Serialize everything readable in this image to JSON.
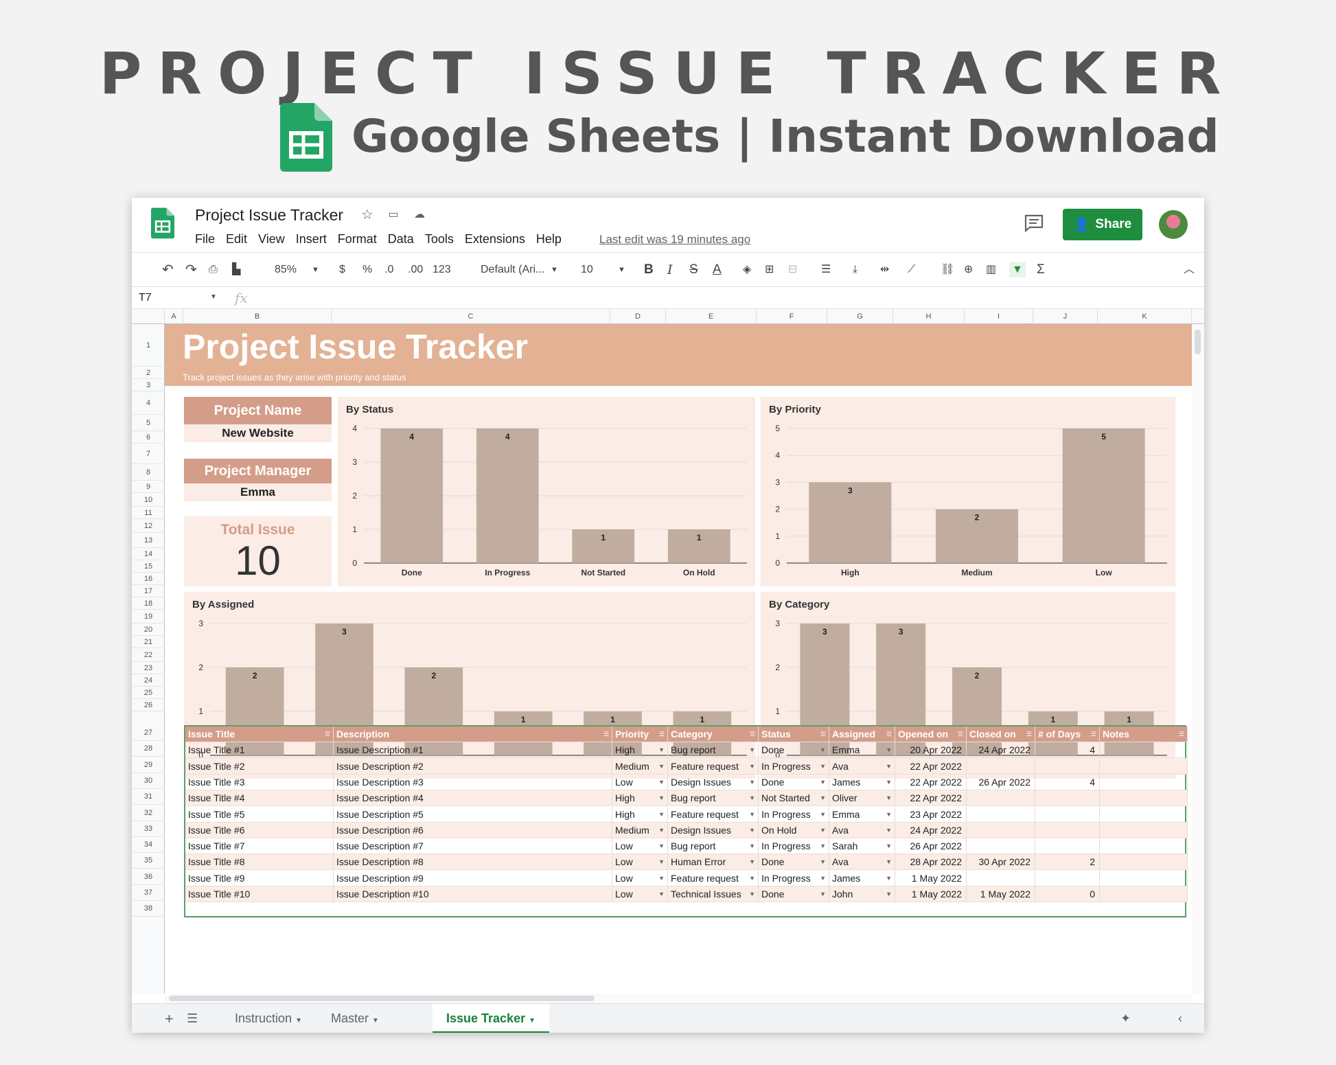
{
  "hero": {
    "title": "PROJECT ISSUE TRACKER",
    "subtitle": "Google Sheets | Instant Download"
  },
  "window": {
    "doc_title": "Project Issue Tracker",
    "menu": [
      "File",
      "Edit",
      "View",
      "Insert",
      "Format",
      "Data",
      "Tools",
      "Extensions",
      "Help"
    ],
    "last_edit": "Last edit was 19 minutes ago",
    "share_label": "Share"
  },
  "toolbar": {
    "zoom": "85%",
    "currency": "$",
    "percent": "%",
    "dec_less": ".0",
    "dec_more": ".00",
    "format": "123",
    "font": "Default (Ari...",
    "size": "10"
  },
  "formula": {
    "cell_ref": "T7",
    "fx": "fx"
  },
  "columns": [
    "A",
    "B",
    "C",
    "D",
    "E",
    "F",
    "G",
    "H",
    "I",
    "J",
    "K"
  ],
  "rows": [
    "1",
    "2",
    "3",
    "4",
    "5",
    "6",
    "7",
    "8",
    "9",
    "10",
    "11",
    "12",
    "13",
    "14",
    "15",
    "16",
    "17",
    "18",
    "19",
    "20",
    "21",
    "22",
    "23",
    "24",
    "25",
    "26",
    "27",
    "28",
    "29",
    "30",
    "31",
    "32",
    "33",
    "34",
    "35",
    "36",
    "37",
    "38"
  ],
  "banner": {
    "title": "Project Issue Tracker",
    "subtitle": "Track project issues as they arise with priority and status"
  },
  "info": {
    "project_name_label": "Project Name",
    "project_name": "New Website",
    "manager_label": "Project Manager",
    "manager": "Emma",
    "total_label": "Total Issue",
    "total": "10"
  },
  "chart_data": [
    {
      "type": "bar",
      "title": "By Status",
      "categories": [
        "Done",
        "In Progress",
        "Not Started",
        "On Hold"
      ],
      "values": [
        4,
        4,
        1,
        1
      ],
      "ylim": [
        0,
        4
      ],
      "yticks": [
        0,
        1,
        2,
        3,
        4
      ],
      "grid": true
    },
    {
      "type": "bar",
      "title": "By Priority",
      "categories": [
        "High",
        "Medium",
        "Low"
      ],
      "values": [
        3,
        2,
        5
      ],
      "ylim": [
        0,
        5
      ],
      "yticks": [
        0,
        1,
        2,
        3,
        4,
        5
      ],
      "grid": true
    },
    {
      "type": "bar",
      "title": "By Assigned",
      "categories": [
        "Emma",
        "Ava",
        "James",
        "Oliver",
        "Sarah",
        "John"
      ],
      "values": [
        2,
        3,
        2,
        1,
        1,
        1
      ],
      "ylim": [
        0,
        3
      ],
      "yticks": [
        0,
        1,
        2,
        3
      ],
      "grid": true
    },
    {
      "type": "bar",
      "title": "By Category",
      "categories": [
        "Bug report",
        "Feature request",
        "Design Issues",
        "Human Error",
        "Technical Issues"
      ],
      "values": [
        3,
        3,
        2,
        1,
        1
      ],
      "ylim": [
        0,
        3
      ],
      "yticks": [
        0,
        1,
        2,
        3
      ],
      "grid": true
    }
  ],
  "table": {
    "headers": [
      "Issue Title",
      "Description",
      "Priority",
      "Category",
      "Status",
      "Assigned",
      "Opened on",
      "Closed on",
      "# of Days",
      "Notes"
    ],
    "rows": [
      [
        "Issue Title #1",
        "Issue Description #1",
        "High",
        "Bug report",
        "Done",
        "Emma",
        "20 Apr 2022",
        "24 Apr 2022",
        "4",
        ""
      ],
      [
        "Issue Title #2",
        "Issue Description #2",
        "Medium",
        "Feature request",
        "In Progress",
        "Ava",
        "22 Apr 2022",
        "",
        "",
        ""
      ],
      [
        "Issue Title #3",
        "Issue Description #3",
        "Low",
        "Design Issues",
        "Done",
        "James",
        "22 Apr 2022",
        "26 Apr 2022",
        "4",
        ""
      ],
      [
        "Issue Title #4",
        "Issue Description #4",
        "High",
        "Bug report",
        "Not Started",
        "Oliver",
        "22 Apr 2022",
        "",
        "",
        ""
      ],
      [
        "Issue Title #5",
        "Issue Description #5",
        "High",
        "Feature request",
        "In Progress",
        "Emma",
        "23 Apr 2022",
        "",
        "",
        ""
      ],
      [
        "Issue Title #6",
        "Issue Description #6",
        "Medium",
        "Design Issues",
        "On Hold",
        "Ava",
        "24 Apr 2022",
        "",
        "",
        ""
      ],
      [
        "Issue Title #7",
        "Issue Description #7",
        "Low",
        "Bug report",
        "In Progress",
        "Sarah",
        "26 Apr 2022",
        "",
        "",
        ""
      ],
      [
        "Issue Title #8",
        "Issue Description #8",
        "Low",
        "Human Error",
        "Done",
        "Ava",
        "28 Apr 2022",
        "30 Apr 2022",
        "2",
        ""
      ],
      [
        "Issue Title #9",
        "Issue Description #9",
        "Low",
        "Feature request",
        "In Progress",
        "James",
        "1 May 2022",
        "",
        "",
        ""
      ],
      [
        "Issue Title #10",
        "Issue Description #10",
        "Low",
        "Technical Issues",
        "Done",
        "John",
        "1 May 2022",
        "1 May 2022",
        "0",
        ""
      ]
    ]
  },
  "tabs": [
    "Instruction",
    "Master",
    "Issue Tracker"
  ],
  "colors": {
    "bar": "#c0ad9f",
    "header": "#d49d89",
    "banner": "#e3b194",
    "panel": "#fbece5",
    "accent": "#1e8e3e"
  }
}
